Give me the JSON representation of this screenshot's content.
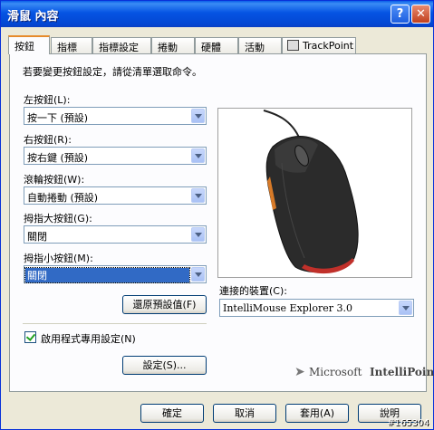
{
  "window": {
    "title": "滑鼠 內容",
    "help_label": "?",
    "close_label": "✕"
  },
  "tabs": [
    {
      "label": "按鈕"
    },
    {
      "label": "指標"
    },
    {
      "label": "指標設定"
    },
    {
      "label": "捲動"
    },
    {
      "label": "硬體"
    },
    {
      "label": "活動"
    },
    {
      "label": "TrackPoint"
    }
  ],
  "intro": "若要變更按鈕設定，請從清單選取命令。",
  "buttons": {
    "left": {
      "label": "左按鈕(L):",
      "value": "按一下 (預設)"
    },
    "right": {
      "label": "右按鈕(R):",
      "value": "按右鍵 (預設)"
    },
    "wheel": {
      "label": "滾輪按鈕(W):",
      "value": "自動捲動 (預設)"
    },
    "thumb_big": {
      "label": "拇指大按鈕(G):",
      "value": "關閉"
    },
    "thumb_small": {
      "label": "拇指小按鈕(M):",
      "value": "關閉"
    }
  },
  "restore_label": "還原預設值(F)",
  "app_specific_label": "啟用程式專用設定(N)",
  "settings_label": "設定(S)...",
  "connected": {
    "label": "連接的裝置(C):",
    "value": "IntelliMouse Explorer 3.0"
  },
  "logo": {
    "microsoft": "Microsoft",
    "product": "IntelliPoint"
  },
  "footer": {
    "ok": "確定",
    "cancel": "取消",
    "apply": "套用(A)",
    "help": "說明"
  },
  "watermark": "#165304"
}
